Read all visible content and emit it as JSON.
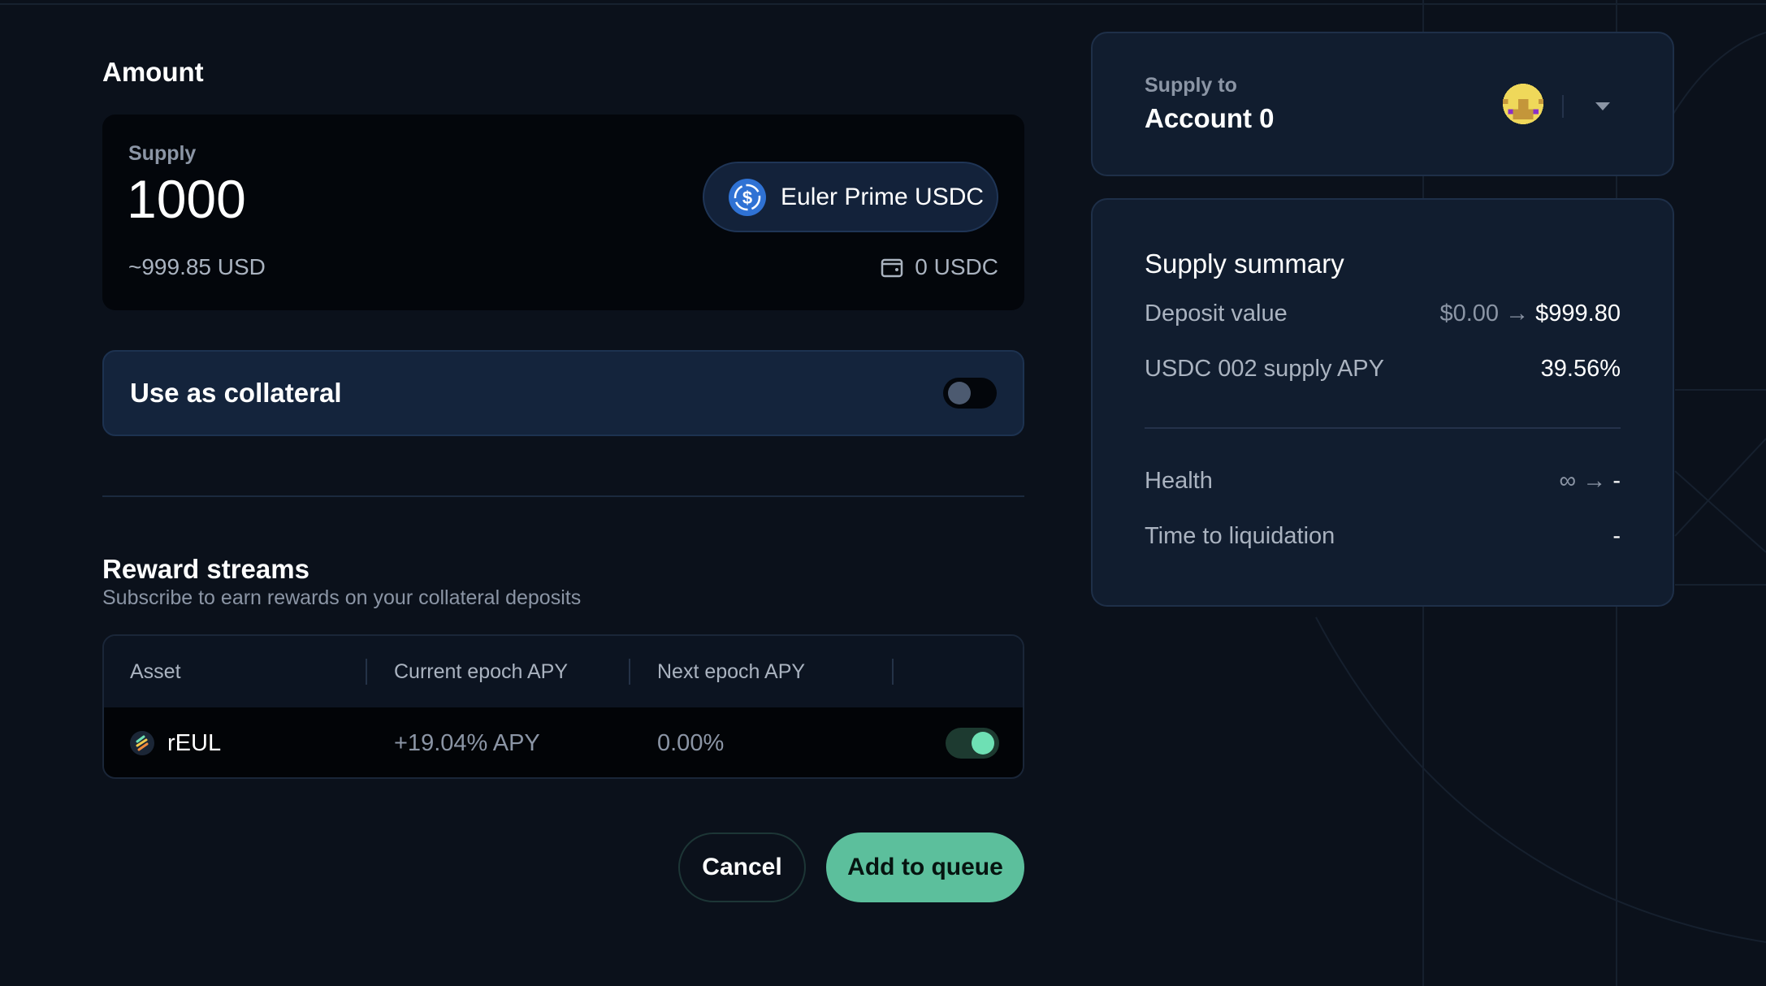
{
  "amount": {
    "title": "Amount",
    "supply_label": "Supply",
    "value": "1000",
    "usd_value": "~999.85 USD",
    "token": "Euler Prime USDC",
    "token_icon": "usdc-icon",
    "wallet_balance": "0 USDC",
    "wallet_icon": "wallet-icon"
  },
  "collateral": {
    "label": "Use as collateral",
    "enabled": false
  },
  "rewards": {
    "title": "Reward streams",
    "subtitle": "Subscribe to earn rewards on your collateral deposits",
    "columns": [
      "Asset",
      "Current epoch APY",
      "Next epoch APY"
    ],
    "rows": [
      {
        "asset": "rEUL",
        "current_apy": "+19.04% APY",
        "next_apy": "0.00%",
        "subscribed": true
      }
    ]
  },
  "actions": {
    "cancel": "Cancel",
    "add": "Add to queue"
  },
  "supply_to": {
    "label": "Supply to",
    "account": "Account 0"
  },
  "summary": {
    "title": "Supply summary",
    "deposit_label": "Deposit value",
    "deposit_from": "$0.00",
    "deposit_to": "$999.80",
    "apy_label": "USDC 002 supply APY",
    "apy_value": "39.56%",
    "health_label": "Health",
    "health_from": "∞",
    "health_to": "-",
    "ttl_label": "Time to liquidation",
    "ttl_value": "-"
  },
  "colors": {
    "accent": "#5cbf9c",
    "toggle_on": "#6ee0b4",
    "background": "#0b111b",
    "card": "#111d2f"
  }
}
